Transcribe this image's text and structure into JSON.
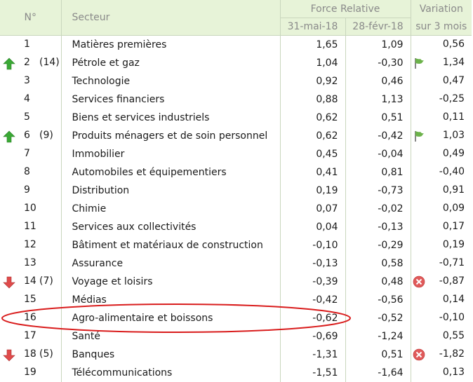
{
  "header": {
    "rank": "N°",
    "sector": "Secteur",
    "force_relative": "Force Relative",
    "date1": "31-mai-18",
    "date2": "28-févr-18",
    "variation": "Variation",
    "variation_sub": "sur 3 mois"
  },
  "colors": {
    "header_bg": "#e7f3d8",
    "arrow_up": "#3aa935",
    "arrow_down": "#e04b4b",
    "highlight_ellipse": "#d91c1c",
    "flag": "#6cb24a",
    "cancel": "#e05a5a"
  },
  "rows": [
    {
      "rank": "1",
      "prev": "",
      "trend": "",
      "sector": "Matières premières",
      "fr_may": "1,65",
      "fr_feb": "1,09",
      "variation": "0,56",
      "var_icon": ""
    },
    {
      "rank": "2",
      "prev": "(14)",
      "trend": "up",
      "sector": "Pétrole et gaz",
      "fr_may": "1,04",
      "fr_feb": "-0,30",
      "variation": "1,34",
      "var_icon": "flag"
    },
    {
      "rank": "3",
      "prev": "",
      "trend": "",
      "sector": "Technologie",
      "fr_may": "0,92",
      "fr_feb": "0,46",
      "variation": "0,47",
      "var_icon": ""
    },
    {
      "rank": "4",
      "prev": "",
      "trend": "",
      "sector": "Services financiers",
      "fr_may": "0,88",
      "fr_feb": "1,13",
      "variation": "-0,25",
      "var_icon": ""
    },
    {
      "rank": "5",
      "prev": "",
      "trend": "",
      "sector": "Biens et services industriels",
      "fr_may": "0,62",
      "fr_feb": "0,51",
      "variation": "0,11",
      "var_icon": ""
    },
    {
      "rank": "6",
      "prev": "(9)",
      "trend": "up",
      "sector": "Produits ménagers et de soin personnel",
      "fr_may": "0,62",
      "fr_feb": "-0,42",
      "variation": "1,03",
      "var_icon": "flag"
    },
    {
      "rank": "7",
      "prev": "",
      "trend": "",
      "sector": "Immobilier",
      "fr_may": "0,45",
      "fr_feb": "-0,04",
      "variation": "0,49",
      "var_icon": ""
    },
    {
      "rank": "8",
      "prev": "",
      "trend": "",
      "sector": "Automobiles et équipementiers",
      "fr_may": "0,41",
      "fr_feb": "0,81",
      "variation": "-0,40",
      "var_icon": ""
    },
    {
      "rank": "9",
      "prev": "",
      "trend": "",
      "sector": "Distribution",
      "fr_may": "0,19",
      "fr_feb": "-0,73",
      "variation": "0,91",
      "var_icon": ""
    },
    {
      "rank": "10",
      "prev": "",
      "trend": "",
      "sector": "Chimie",
      "fr_may": "0,07",
      "fr_feb": "-0,02",
      "variation": "0,09",
      "var_icon": ""
    },
    {
      "rank": "11",
      "prev": "",
      "trend": "",
      "sector": "Services aux collectivités",
      "fr_may": "0,04",
      "fr_feb": "-0,13",
      "variation": "0,17",
      "var_icon": ""
    },
    {
      "rank": "12",
      "prev": "",
      "trend": "",
      "sector": "Bâtiment et matériaux de construction",
      "fr_may": "-0,10",
      "fr_feb": "-0,29",
      "variation": "0,19",
      "var_icon": ""
    },
    {
      "rank": "13",
      "prev": "",
      "trend": "",
      "sector": "Assurance",
      "fr_may": "-0,13",
      "fr_feb": "0,58",
      "variation": "-0,71",
      "var_icon": ""
    },
    {
      "rank": "14",
      "prev": "(7)",
      "trend": "down",
      "sector": "Voyage et loisirs",
      "fr_may": "-0,39",
      "fr_feb": "0,48",
      "variation": "-0,87",
      "var_icon": "cancel"
    },
    {
      "rank": "15",
      "prev": "",
      "trend": "",
      "sector": "Médias",
      "fr_may": "-0,42",
      "fr_feb": "-0,56",
      "variation": "0,14",
      "var_icon": ""
    },
    {
      "rank": "16",
      "prev": "",
      "trend": "",
      "sector": "Agro-alimentaire et boissons",
      "fr_may": "-0,62",
      "fr_feb": "-0,52",
      "variation": "-0,10",
      "var_icon": ""
    },
    {
      "rank": "17",
      "prev": "",
      "trend": "",
      "sector": "Santé",
      "fr_may": "-0,69",
      "fr_feb": "-1,24",
      "variation": "0,55",
      "var_icon": ""
    },
    {
      "rank": "18",
      "prev": "(5)",
      "trend": "down",
      "sector": "Banques",
      "fr_may": "-1,31",
      "fr_feb": "0,51",
      "variation": "-1,82",
      "var_icon": "cancel"
    },
    {
      "rank": "19",
      "prev": "",
      "trend": "",
      "sector": "Télécommunications",
      "fr_may": "-1,51",
      "fr_feb": "-1,64",
      "variation": "0,13",
      "var_icon": ""
    }
  ]
}
